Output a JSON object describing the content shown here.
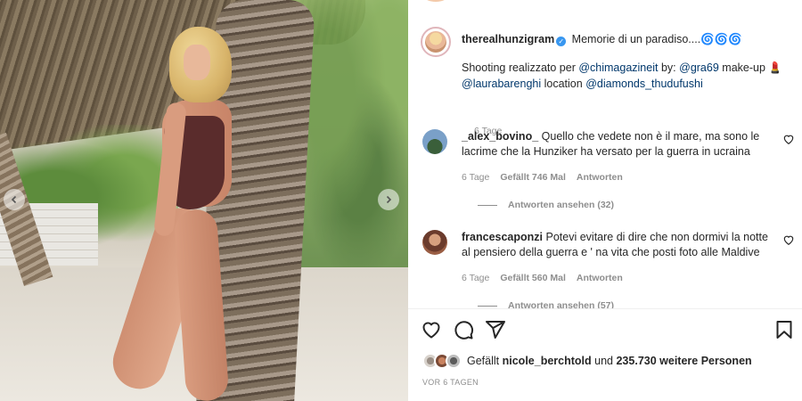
{
  "post": {
    "username": "therealhunzigram",
    "caption_title": "Memorie di un paradiso....",
    "caption_emoji": "🌀🌀🌀",
    "caption_prefix": "Shooting realizzato per",
    "mention_magazine": "@chimagazineit",
    "by_label": "by:",
    "mention_photographer": "@gra69",
    "makeup_label": "make-up",
    "makeup_emoji": "💄",
    "mention_makeup": "@laurabarenghi",
    "location_label": "location",
    "mention_location": "@diamonds_thudufushi",
    "time": "6 Tage"
  },
  "comments": [
    {
      "username": "_alex_bovino_",
      "text": "Quello che vedete non è il mare, ma sono le lacrime che la Hunziker ha versato per la guerra in ucraina",
      "time": "6 Tage",
      "likes": "Gefällt 746 Mal",
      "reply": "Antworten",
      "view_replies": "Antworten ansehen (32)"
    },
    {
      "username": "francescaponzi",
      "text": "Potevi evitare di dire che non dormivi la notte al pensiero della guerra e ' na vita che posti foto alle Maldive",
      "time": "6 Tage",
      "likes": "Gefällt 560 Mal",
      "reply": "Antworten",
      "view_replies": "Antworten ansehen (57)"
    }
  ],
  "likes": {
    "prefix": "Gefällt",
    "user": "nicole_berchtold",
    "joiner": "und",
    "others": "235.730 weitere Personen"
  },
  "post_time": "VOR 6 TAGEN",
  "icons": {
    "like": "heart-icon",
    "comment": "comment-icon",
    "share": "send-icon",
    "save": "bookmark-icon",
    "prev": "chevron-left-icon",
    "next": "chevron-right-icon"
  },
  "colors": {
    "link": "#00376b",
    "meta": "#8e8e8e",
    "verified": "#3897f0"
  }
}
